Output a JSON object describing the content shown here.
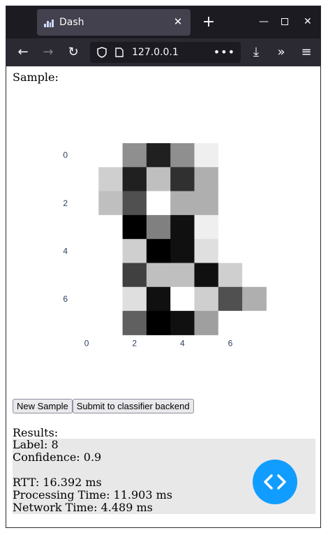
{
  "browser": {
    "tab_title": "Dash",
    "url": "127.0.0.1"
  },
  "page": {
    "sample_label": "Sample:",
    "results_label": "Results:",
    "new_sample_label": "New Sample",
    "submit_label": "Submit to classifier backend",
    "results": {
      "label_line": "Label: 8",
      "confidence_line": "Confidence: 0.9",
      "rtt_line": "RTT: 16.392 ms",
      "processing_line": "Processing Time: 11.903 ms",
      "network_line": "Network Time: 4.489 ms"
    }
  },
  "chart_data": {
    "type": "heatmap",
    "colorscale": "gray",
    "x_ticks": [
      0,
      2,
      4,
      6
    ],
    "y_ticks": [
      0,
      2,
      4,
      6
    ],
    "x_range": [
      0,
      7
    ],
    "y_range": [
      0,
      7
    ],
    "z": [
      [
        0,
        0,
        7,
        14,
        7,
        1,
        0,
        0
      ],
      [
        0,
        3,
        14,
        4,
        13,
        5,
        0,
        0
      ],
      [
        0,
        4,
        11,
        0,
        5,
        5,
        0,
        0
      ],
      [
        0,
        0,
        16,
        8,
        15,
        1,
        0,
        0
      ],
      [
        0,
        0,
        3,
        16,
        15,
        2,
        0,
        0
      ],
      [
        0,
        0,
        12,
        4,
        4,
        15,
        3,
        0
      ],
      [
        0,
        0,
        2,
        15,
        0,
        3,
        11,
        5
      ],
      [
        0,
        0,
        10,
        16,
        15,
        6,
        0,
        0
      ]
    ],
    "zmax": 16
  }
}
